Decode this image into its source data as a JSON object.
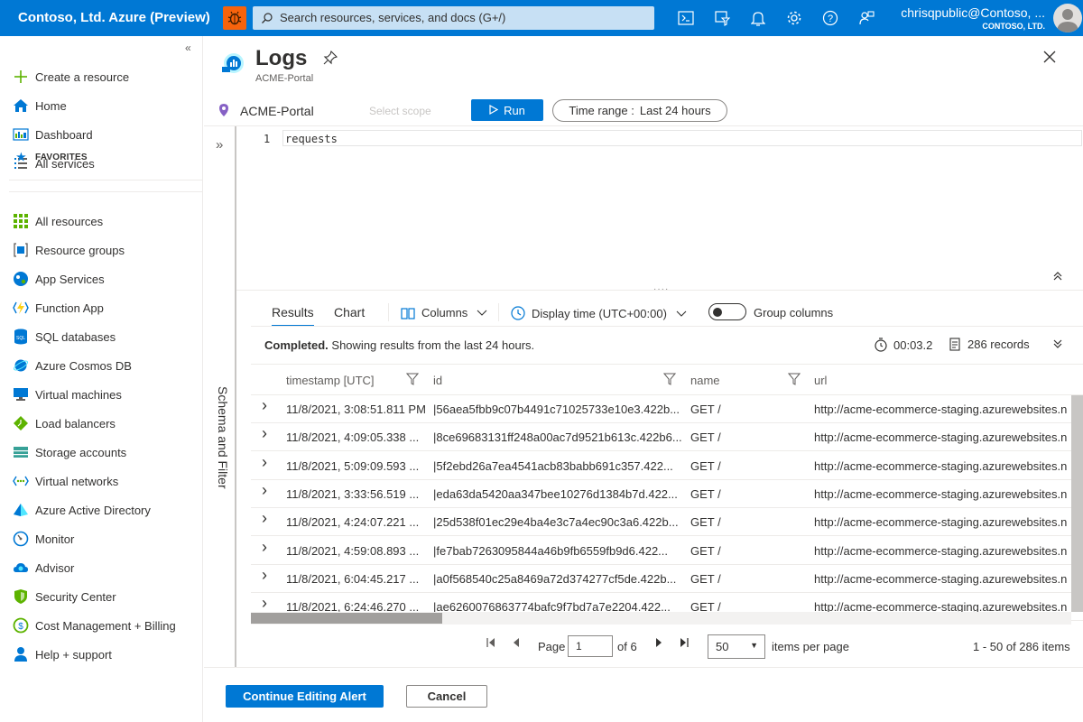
{
  "topbar": {
    "brand": "Contoso, Ltd. Azure (Preview)",
    "search_placeholder": "Search resources, services, and docs (G+/)",
    "user_name": "chrisqpublic@Contoso, ...",
    "user_org": "CONTOSO, LTD."
  },
  "sidebar": {
    "items": [
      {
        "label": "Create a resource",
        "icon": "plus-icon"
      },
      {
        "label": "Home",
        "icon": "home-icon"
      },
      {
        "label": "Dashboard",
        "icon": "dashboard-icon"
      },
      {
        "label": "All services",
        "icon": "list-icon"
      }
    ],
    "favorites_label": "FAVORITES",
    "favorites": [
      {
        "label": "All resources",
        "icon": "grid-icon"
      },
      {
        "label": "Resource groups",
        "icon": "resource-group-icon"
      },
      {
        "label": "App Services",
        "icon": "globe-icon"
      },
      {
        "label": "Function App",
        "icon": "lightning-icon"
      },
      {
        "label": "SQL databases",
        "icon": "sql-icon"
      },
      {
        "label": "Azure Cosmos DB",
        "icon": "cosmos-icon"
      },
      {
        "label": "Virtual machines",
        "icon": "monitor-icon"
      },
      {
        "label": "Load balancers",
        "icon": "diamond-icon"
      },
      {
        "label": "Storage accounts",
        "icon": "storage-icon"
      },
      {
        "label": "Virtual networks",
        "icon": "network-icon"
      },
      {
        "label": "Azure Active Directory",
        "icon": "pyramid-icon"
      },
      {
        "label": "Monitor",
        "icon": "gauge-icon"
      },
      {
        "label": "Advisor",
        "icon": "cloud-icon"
      },
      {
        "label": "Security Center",
        "icon": "shield-icon"
      },
      {
        "label": "Cost Management + Billing",
        "icon": "coin-icon"
      },
      {
        "label": "Help + support",
        "icon": "person-icon"
      }
    ]
  },
  "header": {
    "title": "Logs",
    "subtitle": "ACME-Portal"
  },
  "scope": {
    "name": "ACME-Portal",
    "select_label": "Select scope",
    "run_label": "Run",
    "time_range_label": "Time range :",
    "time_range_value": "Last 24 hours"
  },
  "side_panel_label": "Schema and Filter",
  "editor": {
    "line_number": "1",
    "query": "requests"
  },
  "results": {
    "tabs": [
      "Results",
      "Chart"
    ],
    "columns_label": "Columns",
    "display_time_label": "Display time (UTC+00:00)",
    "group_columns_label": "Group columns",
    "status_bold": "Completed.",
    "status_text": " Showing results from the last 24 hours.",
    "duration": "00:03.2",
    "records": "286 records",
    "headers": [
      "timestamp [UTC]",
      "id",
      "name",
      "url"
    ],
    "rows": [
      [
        "11/8/2021, 3:08:51.811 PM",
        "|56aea5fbb9c07b4491c71025733e10e3.422b...",
        "GET /",
        "http://acme-ecommerce-staging.azurewebsites.n"
      ],
      [
        "11/8/2021, 4:09:05.338 ...",
        "|8ce69683131ff248a00ac7d9521b613c.422b6...",
        "GET /",
        "http://acme-ecommerce-staging.azurewebsites.n"
      ],
      [
        "11/8/2021, 5:09:09.593 ...",
        "|5f2ebd26a7ea4541acb83babb691c357.422...",
        "GET /",
        "http://acme-ecommerce-staging.azurewebsites.n"
      ],
      [
        "11/8/2021, 3:33:56.519 ...",
        "|eda63da5420aa347bee10276d1384b7d.422...",
        "GET /",
        "http://acme-ecommerce-staging.azurewebsites.n"
      ],
      [
        "11/8/2021, 4:24:07.221 ...",
        "|25d538f01ec29e4ba4e3c7a4ec90c3a6.422b...",
        "GET /",
        "http://acme-ecommerce-staging.azurewebsites.n"
      ],
      [
        "11/8/2021, 4:59:08.893 ...",
        "|fe7bab7263095844a46b9fb6559fb9d6.422...",
        "GET /",
        "http://acme-ecommerce-staging.azurewebsites.n"
      ],
      [
        "11/8/2021, 6:04:45.217 ...",
        "|a0f568540c25a8469a72d374277cf5de.422b...",
        "GET /",
        "http://acme-ecommerce-staging.azurewebsites.n"
      ],
      [
        "11/8/2021, 6:24:46.270 ...",
        "|ae6260076863774bafc9f7bd7a7e2204.422...",
        "GET /",
        "http://acme-ecommerce-staging.azurewebsites.n"
      ]
    ]
  },
  "pager": {
    "page_label": "Page",
    "page_value": "1",
    "of_label": "of 6",
    "per_page_value": "50",
    "per_page_label": "items per page",
    "summary": "1 - 50 of 286 items"
  },
  "footer": {
    "primary_label": "Continue Editing Alert",
    "cancel_label": "Cancel"
  },
  "colors": {
    "accent": "#0078d4",
    "bug_button": "#f7630c"
  }
}
